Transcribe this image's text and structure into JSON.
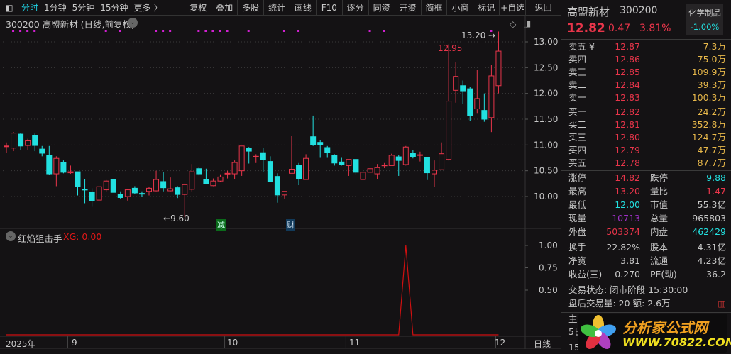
{
  "toolbar": {
    "period_tabs": [
      "分时",
      "1分钟",
      "5分钟",
      "15分钟",
      "更多 〉"
    ],
    "buttons": [
      "复权",
      "叠加",
      "多股",
      "统计",
      "画线",
      "F10",
      "逐分",
      "同资",
      "开资",
      "简框",
      "小窗",
      "标记",
      "+自选",
      "返回"
    ]
  },
  "chart_header": {
    "title": "300200 高盟新材 (日线,前复权)"
  },
  "indicator": {
    "name": "红焰狙击手",
    "value_label": "XG: 0.00"
  },
  "annotations": {
    "high_label": "13.20",
    "peak_label": "12.95",
    "low_label": "9.60",
    "event_jian": "减",
    "event_cai": "财"
  },
  "x_labels": [
    "2025年",
    "9",
    "10",
    "11",
    "12"
  ],
  "period_label": "日线",
  "colors": {
    "up": "#e8354a",
    "down": "#22e0e0",
    "bg": "#141214",
    "marker": "#d020d0"
  },
  "chart_data": {
    "type": "candlestick",
    "y_ticks": [
      "13.00",
      "12.50",
      "12.00",
      "11.50",
      "11.00",
      "10.50",
      "10.00"
    ],
    "ylim": [
      9.6,
      13.2
    ],
    "candles_ochl_note": "[open, close, high, low]",
    "candles": [
      [
        10.98,
        10.98,
        11.05,
        10.85
      ],
      [
        10.94,
        11.23,
        11.25,
        10.88
      ],
      [
        11.21,
        10.98,
        11.23,
        10.9
      ],
      [
        10.99,
        11.08,
        11.12,
        10.9
      ],
      [
        11.18,
        10.99,
        11.22,
        10.88
      ],
      [
        10.92,
        10.84,
        10.98,
        10.78
      ],
      [
        10.8,
        10.44,
        10.98,
        10.42
      ],
      [
        10.44,
        10.74,
        10.78,
        10.2
      ],
      [
        10.66,
        10.47,
        10.7,
        10.45
      ],
      [
        10.46,
        10.48,
        10.6,
        10.44
      ],
      [
        10.48,
        10.19,
        10.48,
        10.02
      ],
      [
        10.14,
        10.13,
        10.34,
        9.87
      ],
      [
        10.09,
        9.92,
        10.16,
        9.8
      ],
      [
        9.93,
        10.19,
        10.19,
        9.93
      ],
      [
        10.13,
        10.3,
        10.32,
        10.1
      ],
      [
        10.33,
        10.08,
        10.33,
        10.08
      ],
      [
        10.04,
        9.98,
        10.1,
        9.95
      ],
      [
        10.0,
        10.13,
        10.15,
        9.92
      ],
      [
        10.16,
        10.07,
        10.2,
        10.05
      ],
      [
        10.06,
        10.05,
        10.1,
        10.0
      ],
      [
        10.1,
        10.16,
        10.18,
        10.02
      ],
      [
        10.11,
        10.33,
        10.5,
        10.1
      ],
      [
        10.29,
        10.17,
        10.47,
        10.1
      ],
      [
        10.11,
        10.15,
        10.37,
        10.1
      ],
      [
        10.17,
        10.04,
        10.2,
        9.97
      ],
      [
        10.04,
        10.23,
        10.25,
        9.6
      ],
      [
        10.14,
        10.48,
        10.63,
        10.1
      ],
      [
        10.54,
        10.44,
        10.57,
        10.41
      ],
      [
        10.33,
        10.25,
        10.54,
        10.24
      ],
      [
        10.21,
        10.3,
        10.35,
        10.2
      ],
      [
        10.3,
        10.38,
        10.43,
        10.28
      ],
      [
        10.44,
        10.45,
        10.5,
        10.35
      ],
      [
        10.44,
        10.66,
        10.7,
        10.33
      ],
      [
        10.5,
        10.98,
        10.98,
        10.4
      ],
      [
        10.93,
        10.88,
        10.96,
        10.64
      ],
      [
        10.77,
        10.78,
        10.82,
        10.65
      ],
      [
        10.85,
        10.72,
        10.94,
        10.48
      ],
      [
        10.68,
        10.29,
        10.78,
        10.29
      ],
      [
        10.39,
        10.03,
        10.45,
        9.88
      ],
      [
        10.03,
        10.1,
        10.1,
        9.96
      ],
      [
        10.45,
        10.53,
        11.17,
        10.45
      ],
      [
        10.6,
        10.35,
        10.65,
        10.22
      ],
      [
        10.33,
        10.74,
        10.82,
        10.33
      ],
      [
        11.16,
        11.0,
        11.57,
        10.98
      ],
      [
        11.05,
        11.0,
        11.1,
        10.75
      ],
      [
        10.95,
        10.85,
        10.98,
        10.75
      ],
      [
        10.8,
        10.65,
        10.82,
        10.6
      ],
      [
        10.67,
        10.62,
        10.75,
        10.6
      ],
      [
        10.6,
        10.72,
        10.72,
        10.4
      ],
      [
        10.72,
        10.47,
        10.72,
        10.42
      ],
      [
        10.33,
        10.47,
        10.5,
        10.33
      ],
      [
        10.47,
        10.54,
        10.55,
        10.45
      ],
      [
        10.44,
        10.56,
        10.63,
        10.33
      ],
      [
        10.6,
        10.61,
        10.65,
        10.55
      ],
      [
        10.6,
        10.8,
        10.83,
        10.6
      ],
      [
        10.77,
        10.7,
        10.8,
        10.4
      ],
      [
        10.62,
        10.96,
        10.98,
        10.6
      ],
      [
        10.84,
        10.77,
        10.9,
        10.74
      ],
      [
        10.8,
        10.81,
        10.87,
        10.68
      ],
      [
        10.76,
        10.46,
        10.76,
        10.32
      ],
      [
        10.44,
        10.51,
        10.7,
        10.18
      ],
      [
        10.52,
        10.83,
        11.05,
        10.52
      ],
      [
        10.72,
        11.85,
        12.95,
        10.7
      ],
      [
        12.06,
        12.33,
        12.6,
        11.82
      ],
      [
        12.15,
        12.05,
        12.25,
        11.8
      ],
      [
        12.09,
        11.57,
        12.12,
        11.47
      ],
      [
        11.7,
        11.9,
        12.45,
        11.62
      ],
      [
        11.67,
        11.5,
        12.0,
        11.45
      ],
      [
        11.53,
        12.34,
        12.55,
        11.25
      ],
      [
        12.15,
        12.82,
        13.2,
        12.0
      ]
    ],
    "marker_indices": [
      1,
      2,
      3,
      4,
      14,
      16,
      21,
      22,
      23,
      27,
      28,
      29,
      30,
      31,
      34,
      39,
      41,
      51,
      53,
      68
    ],
    "month_start_indices": {
      "9": 9,
      "10": 31,
      "11": 48,
      "12": 69
    },
    "indicator_series": {
      "name": "XG",
      "ticks": [
        "1.00",
        "0.75",
        "0.50"
      ],
      "ylim": [
        0,
        1
      ],
      "spike_index": 56,
      "spike_value": 1.0
    }
  },
  "quote": {
    "name": "高盟新材",
    "code": "300200",
    "price": "12.82",
    "change": "0.47",
    "pct": "3.81%",
    "sector": "化学制品",
    "sector_pct": "-1.00%"
  },
  "asks": [
    {
      "label": "卖五 ¥",
      "price": "12.87",
      "vol": "7.3万"
    },
    {
      "label": "卖四",
      "price": "12.86",
      "vol": "75.0万"
    },
    {
      "label": "卖三",
      "price": "12.85",
      "vol": "109.9万"
    },
    {
      "label": "卖二",
      "price": "12.84",
      "vol": "39.3万"
    },
    {
      "label": "卖一",
      "price": "12.83",
      "vol": "100.3万"
    }
  ],
  "bids": [
    {
      "label": "买一",
      "price": "12.82",
      "vol": "24.2万"
    },
    {
      "label": "买二",
      "price": "12.81",
      "vol": "352.8万"
    },
    {
      "label": "买三",
      "price": "12.80",
      "vol": "124.7万"
    },
    {
      "label": "买四",
      "price": "12.79",
      "vol": "47.7万"
    },
    {
      "label": "买五",
      "price": "12.78",
      "vol": "87.7万"
    }
  ],
  "stats": [
    {
      "l1": "涨停",
      "v1": "14.82",
      "c1": "red",
      "l2": "跌停",
      "v2": "9.88",
      "c2": "cyan"
    },
    {
      "l1": "最高",
      "v1": "13.20",
      "c1": "red",
      "l2": "量比",
      "v2": "1.47",
      "c2": "red"
    },
    {
      "l1": "最低",
      "v1": "12.00",
      "c1": "cyan",
      "l2": "市值",
      "v2": "55.3亿",
      "c2": "gray"
    },
    {
      "l1": "现量",
      "v1": "10713",
      "c1": "pur",
      "l2": "总量",
      "v2": "965803",
      "c2": "gray"
    },
    {
      "l1": "外盘",
      "v1": "503374",
      "c1": "red",
      "l2": "内盘",
      "v2": "462429",
      "c2": "cyan"
    }
  ],
  "fin": [
    {
      "l1": "换手",
      "v1": "22.82%",
      "l2": "股本",
      "v2": "4.31亿"
    },
    {
      "l1": "净资",
      "v1": "3.81",
      "l2": "流通",
      "v2": "4.23亿"
    },
    {
      "l1": "收益(三)",
      "v1": "0.270",
      "l2": "PE(动)",
      "v2": "36.2"
    }
  ],
  "status": {
    "trade_state": "交易状态: 闭市阶段 15:30:00",
    "after_hours": "盘后交易量: 20  额: 2.6万",
    "row_a": "主力",
    "row_b": "5日",
    "row_c": "15:"
  },
  "watermark": {
    "title": "分析家公式网",
    "url": "WWW.70822.COM"
  }
}
